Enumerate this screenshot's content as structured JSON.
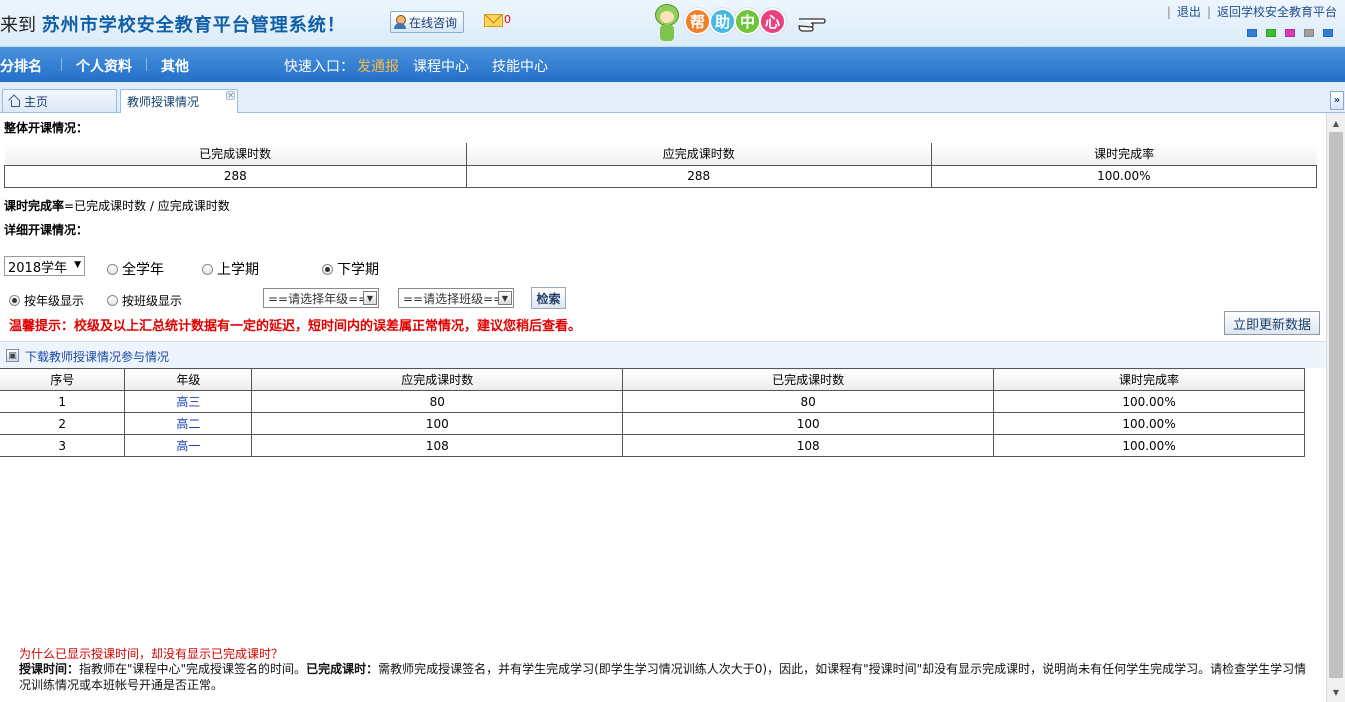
{
  "header": {
    "welcome_prefix": "来到",
    "system_name": "苏州市学校安全教育平台管理系统！",
    "consult_label": "在线咨询",
    "mail_count": "0",
    "help_chars": [
      "帮",
      "助",
      "中",
      "心"
    ],
    "help_colors": [
      "#f07f28",
      "#49b7e6",
      "#6fc43c",
      "#e8417f"
    ],
    "logout": "退出",
    "return_platform": "返回学校安全教育平台",
    "skin_colors": [
      "#2f7fd8",
      "#3cbf2e",
      "#d63ab8",
      "#a0a0a0",
      "#2f7fd8"
    ]
  },
  "nav": {
    "items": [
      "积分排名",
      "个人资料",
      "其他"
    ],
    "quick_label": "快速入口：",
    "quick_fatongbao": "发通报",
    "quick_course": "课程中心",
    "quick_skill": "技能中心"
  },
  "tabs": {
    "home": "主页",
    "teacher": "教师授课情况",
    "close_glyph": "×",
    "scroll_glyph": "»"
  },
  "overall": {
    "label": "整体开课情况：",
    "headers": [
      "已完成课时数",
      "应完成课时数",
      "课时完成率"
    ],
    "values": [
      "288",
      "288",
      "100.00%"
    ],
    "formula": "课时完成率=已完成课时数 / 应完成课时数"
  },
  "detail": {
    "label": "详细开课情况：",
    "year": "2018学年",
    "period_options": [
      "全学年",
      "上学期",
      "下学期"
    ],
    "period_selected": "下学期",
    "display_options": [
      "按年级显示",
      "按班级显示"
    ],
    "display_selected": "按年级显示",
    "grade_placeholder": "==请选择年级==",
    "class_placeholder": "==请选择班级==",
    "search_label": "检索",
    "notice": "温馨提示：校级及以上汇总统计数据有一定的延迟，短时间内的误差属正常情况，建议您稍后查看。",
    "refresh_label": "立即更新数据",
    "download_label": "下载教师授课情况参与情况",
    "table_headers": [
      "序号",
      "年级",
      "应完成课时数",
      "已完成课时数",
      "课时完成率"
    ],
    "rows": [
      [
        "1",
        "高三",
        "80",
        "80",
        "100.00%"
      ],
      [
        "2",
        "高二",
        "100",
        "100",
        "100.00%"
      ],
      [
        "3",
        "高一",
        "108",
        "108",
        "100.00%"
      ]
    ]
  },
  "faq": {
    "question": "为什么已显示授课时间，却没有显示已完成课时？",
    "term1": "授课时间：",
    "text1": "指教师在\"课程中心\"完成授课签名的时间。",
    "term2": "已完成课时：",
    "text2": "需教师完成授课签名，并有学生完成学习(即学生学习情况训练人次大于0)，因此，如课程有\"授课时间\"却没有显示完成课时，说明尚未有任何学生完成学习。请检查学生学习情况训练情况或本班帐号开通是否正常。"
  }
}
